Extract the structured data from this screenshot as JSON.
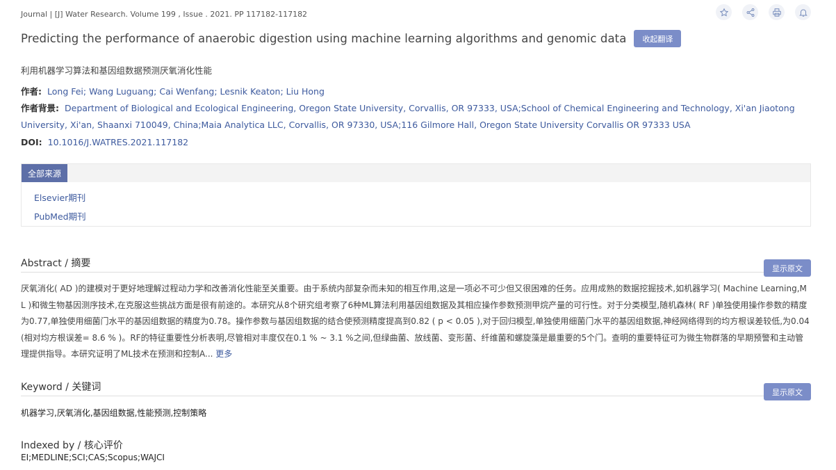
{
  "journal_line": "Journal | [J] Water Research. Volume 199 , Issue . 2021. PP 117182-117182",
  "title": "Predicting the performance of anaerobic digestion using machine learning algorithms and genomic data",
  "translate_button": "收起翻译",
  "subtitle_cn": "利用机器学习算法和基因组数据预测厌氧消化性能",
  "authors": {
    "label": "作者:",
    "value": "Long Fei; Wang Luguang; Cai Wenfang; Lesnik Keaton; Liu Hong"
  },
  "affiliation": {
    "label": "作者背景:",
    "value": "Department of Biological and Ecological Engineering, Oregon State University, Corvallis, OR 97333, USA;School of Chemical Engineering and Technology, Xi'an Jiaotong University, Xi'an, Shaanxi 710049, China;Maia Analytica LLC, Corvallis, OR 97330, USA;116 Gilmore Hall, Oregon State University Corvallis OR 97333 USA"
  },
  "doi": {
    "label": "DOI:",
    "value": "10.1016/J.WATRES.2021.117182"
  },
  "sources": {
    "tab_label": "全部来源",
    "items": [
      "Elsevier期刊",
      "PubMed期刊"
    ]
  },
  "abstract": {
    "title": "Abstract / 摘要",
    "button": "显示原文",
    "text": "厌氧消化( AD )的建模对于更好地理解过程动力学和改善消化性能至关重要。由于系统内部复杂而未知的相互作用,这是一项必不可少但又很困难的任务。应用成熟的数据挖掘技术,如机器学习( Machine Learning,ML )和微生物基因测序技术,在克服这些挑战方面是很有前途的。本研究从8个研究组考察了6种ML算法利用基因组数据及其相应操作参数预测甲烷产量的可行性。对于分类模型,随机森林( RF )单独使用操作参数的精度为0.77,单独使用细菌门水平的基因组数据的精度为0.78。操作参数与基因组数据的结合使预测精度提高到0.82 ( p < 0.05 ),对于回归模型,单独使用细菌门水平的基因组数据,神经网络得到的均方根误差较低,为0.04 (相对均方根误差= 8.6 % )。RF的特征重要性分析表明,尽管相对丰度仅在0.1 % ~ 3.1 %之间,但绿曲菌、放线菌、变形菌、纤维菌和螺旋藻是最重要的5个门。查明的重要特征可为微生物群落的早期预警和主动管理提供指导。本研究证明了ML技术在预测和控制A...",
    "more": " 更多"
  },
  "keyword": {
    "title": "Keyword / 关键词",
    "button": "显示原文",
    "text": "机器学习,厌氧消化,基因组数据,性能预测,控制策略"
  },
  "indexed": {
    "title": "Indexed by / 核心评价",
    "value": "EI;MEDLINE;SCI;CAS;Scopus;WAJCI"
  },
  "colors": {
    "accent": "#7b8dc8",
    "tab": "#5d6fa8",
    "link": "#3d5a9e"
  },
  "icons": [
    "star-icon",
    "share-icon",
    "print-icon",
    "bell-icon"
  ]
}
